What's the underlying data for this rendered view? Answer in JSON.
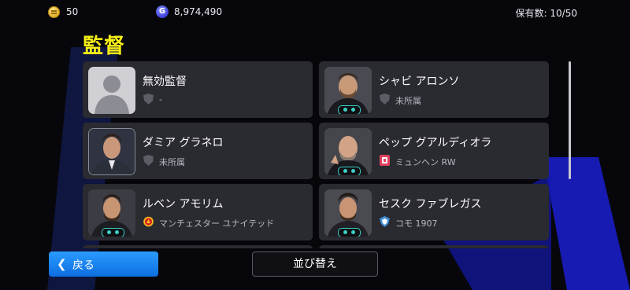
{
  "header": {
    "coin_icon": "coin-icon",
    "coins": "50",
    "gp_icon": "gp-icon",
    "gp_symbol": "G",
    "gp": "8,974,490",
    "owned": "保有数: 10/50"
  },
  "page_title": "監督",
  "managers": [
    {
      "name": "無効監督",
      "team": "-",
      "team_icon": "shield-icon",
      "portrait": "silhouette"
    },
    {
      "name": "シャビ アロンソ",
      "team": "未所属",
      "team_icon": "shield-icon",
      "portrait": "photo"
    },
    {
      "name": "ダミア グラネロ",
      "team": "未所属",
      "team_icon": "shield-icon",
      "portrait": "photo"
    },
    {
      "name": "ペップ グアルディオラ",
      "team": "ミュンヘン RW",
      "team_icon": "munich-crest-icon",
      "portrait": "photo"
    },
    {
      "name": "ルベン アモリム",
      "team": "マンチェスター ユナイテッド",
      "team_icon": "manutd-crest-icon",
      "portrait": "photo"
    },
    {
      "name": "セスク ファブレガス",
      "team": "コモ 1907",
      "team_icon": "como-crest-icon",
      "portrait": "photo"
    }
  ],
  "buttons": {
    "back": "戻る",
    "sort": "並び替え"
  },
  "colors": {
    "title": "#f6ee16",
    "back_button": "#1583f0",
    "card": "#2a2a31",
    "badge": "#3bd0c7"
  }
}
